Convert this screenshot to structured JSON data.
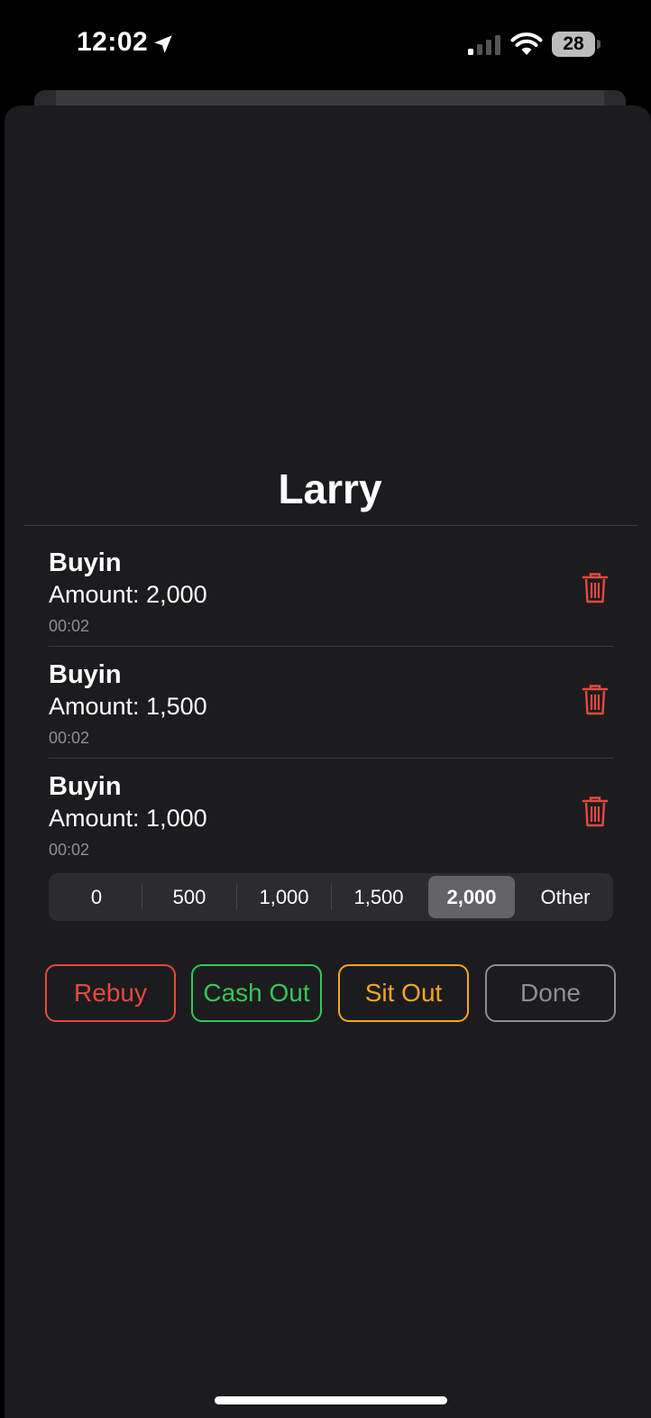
{
  "status_bar": {
    "time": "12:02",
    "battery": "28"
  },
  "player": {
    "name": "Larry"
  },
  "transactions": [
    {
      "type": "Buyin",
      "amount": "Amount: 2,000",
      "time": "00:02"
    },
    {
      "type": "Buyin",
      "amount": "Amount: 1,500",
      "time": "00:02"
    },
    {
      "type": "Buyin",
      "amount": "Amount: 1,000",
      "time": "00:02"
    }
  ],
  "amount_picker": {
    "options": [
      "0",
      "500",
      "1,000",
      "1,500",
      "2,000",
      "Other"
    ],
    "selected": "2,000"
  },
  "actions": {
    "rebuy": "Rebuy",
    "cash_out": "Cash Out",
    "sit_out": "Sit Out",
    "done": "Done"
  },
  "colors": {
    "background": "#1c1c1e",
    "rebuy": "#e5493d",
    "cash_out": "#35c759",
    "sit_out": "#f5a623",
    "done": "#8e8e93",
    "delete": "#e5493d"
  },
  "icons": {
    "location": "location-arrow-icon",
    "signal": "cellular-signal-icon",
    "wifi": "wifi-icon",
    "battery": "battery-icon",
    "delete": "trash-icon"
  }
}
